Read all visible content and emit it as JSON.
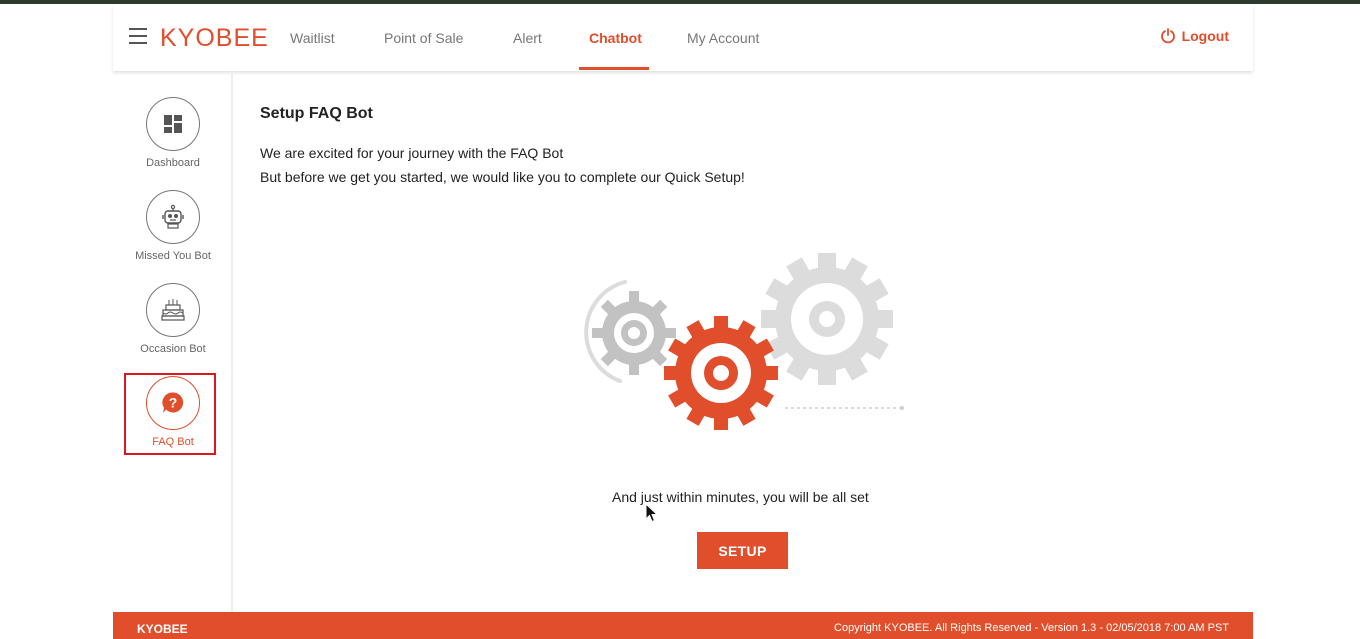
{
  "header": {
    "logo": "KYOBEE",
    "nav": [
      "Waitlist",
      "Point of Sale",
      "Alert",
      "Chatbot",
      "My Account"
    ],
    "active_nav": "Chatbot",
    "logout": "Logout"
  },
  "sidebar": {
    "items": [
      {
        "label": "Dashboard",
        "icon": "dashboard-icon"
      },
      {
        "label": "Missed You Bot",
        "icon": "robot-icon"
      },
      {
        "label": "Occasion Bot",
        "icon": "cake-icon"
      },
      {
        "label": "FAQ Bot",
        "icon": "question-bubble-icon"
      }
    ],
    "active": "FAQ Bot"
  },
  "main": {
    "title": "Setup FAQ Bot",
    "intro_line1": "We are excited for your journey with the FAQ Bot",
    "intro_line2": "But before we get you started, we would like you to complete our Quick Setup!",
    "tagline": "And just within minutes, you will be all set",
    "setup_button": "SETUP"
  },
  "footer": {
    "brand": "KYOBEE",
    "copyright": "Copyright KYOBEE. All Rights Reserved - Version 1.3 - 02/05/2018 7:00 AM PST"
  },
  "colors": {
    "accent": "#e04e2b",
    "highlight_box": "#e0141f",
    "gear_gray": "#c8c8c8",
    "gear_light": "#dcdcdc"
  }
}
